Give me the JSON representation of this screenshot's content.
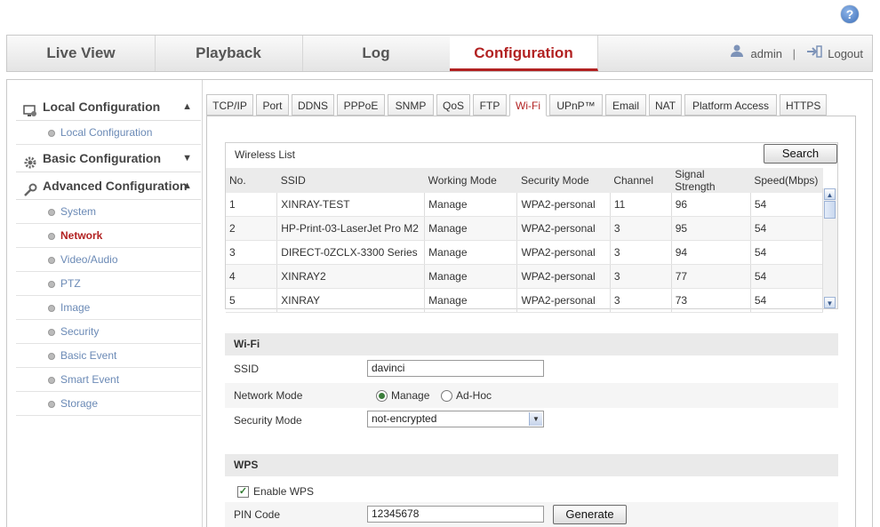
{
  "header": {
    "help_icon": "?",
    "tabs": [
      {
        "label": "Live View"
      },
      {
        "label": "Playback"
      },
      {
        "label": "Log"
      },
      {
        "label": "Configuration"
      }
    ],
    "user": "admin",
    "separator": "|",
    "logout": "Logout"
  },
  "sidebar": {
    "local": {
      "label": "Local Configuration",
      "items": [
        "Local Configuration"
      ]
    },
    "basic": {
      "label": "Basic Configuration"
    },
    "advanced": {
      "label": "Advanced Configuration",
      "items": [
        "System",
        "Network",
        "Video/Audio",
        "PTZ",
        "Image",
        "Security",
        "Basic Event",
        "Smart Event",
        "Storage"
      ]
    }
  },
  "subtabs": [
    "TCP/IP",
    "Port",
    "DDNS",
    "PPPoE",
    "SNMP",
    "QoS",
    "FTP",
    "Wi-Fi",
    "UPnP™",
    "Email",
    "NAT",
    "Platform Access",
    "HTTPS"
  ],
  "wireless_list": {
    "title": "Wireless List",
    "search_label": "Search",
    "columns": [
      "No.",
      "SSID",
      "Working Mode",
      "Security Mode",
      "Channel",
      "Signal Strength",
      "Speed(Mbps)"
    ],
    "rows": [
      [
        "1",
        "XINRAY-TEST",
        "Manage",
        "WPA2-personal",
        "11",
        "96",
        "54"
      ],
      [
        "2",
        "HP-Print-03-LaserJet Pro M2",
        "Manage",
        "WPA2-personal",
        "3",
        "95",
        "54"
      ],
      [
        "3",
        "DIRECT-0ZCLX-3300 Series",
        "Manage",
        "WPA2-personal",
        "3",
        "94",
        "54"
      ],
      [
        "4",
        "XINRAY2",
        "Manage",
        "WPA2-personal",
        "3",
        "77",
        "54"
      ],
      [
        "5",
        "XINRAY",
        "Manage",
        "WPA2-personal",
        "3",
        "73",
        "54"
      ]
    ]
  },
  "wifi": {
    "section_label": "Wi-Fi",
    "ssid_label": "SSID",
    "ssid_value": "davinci",
    "network_mode_label": "Network Mode",
    "mode_manage": "Manage",
    "mode_adhoc": "Ad-Hoc",
    "security_mode_label": "Security Mode",
    "security_mode_value": "not-encrypted"
  },
  "wps": {
    "section_label": "WPS",
    "enable_label": "Enable WPS",
    "pin_label": "PIN Code",
    "pin_value": "12345678",
    "generate_label": "Generate"
  },
  "colors": {
    "accent": "#b22222",
    "link": "#6b8ab6"
  }
}
